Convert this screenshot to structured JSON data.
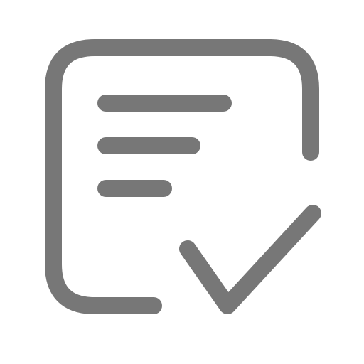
{
  "icon": {
    "name": "task-list-checked-icon",
    "stroke_color": "#777777",
    "background_color": "#ffffff"
  }
}
